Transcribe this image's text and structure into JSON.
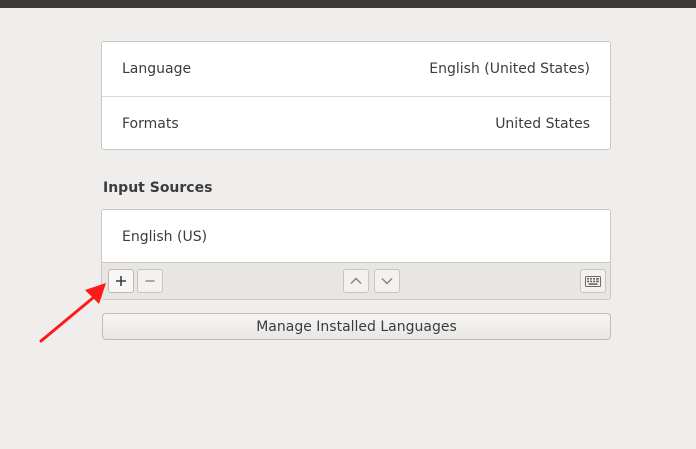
{
  "region": {
    "rows": [
      {
        "label": "Language",
        "value": "English (United States)"
      },
      {
        "label": "Formats",
        "value": "United States"
      }
    ]
  },
  "input_sources": {
    "title": "Input Sources",
    "items": [
      "English (US)"
    ],
    "toolbar": {
      "add_icon": "plus-icon",
      "remove_icon": "minus-icon",
      "up_icon": "chevron-up-icon",
      "down_icon": "chevron-down-icon",
      "keyboard_icon": "keyboard-icon"
    }
  },
  "manage_button": {
    "label": "Manage Installed Languages"
  },
  "annotation": {
    "color": "#ff1a1a",
    "shape": "red-arrow"
  },
  "colors": {
    "titlebar": "#3b3a36",
    "background": "#f0eeec"
  }
}
